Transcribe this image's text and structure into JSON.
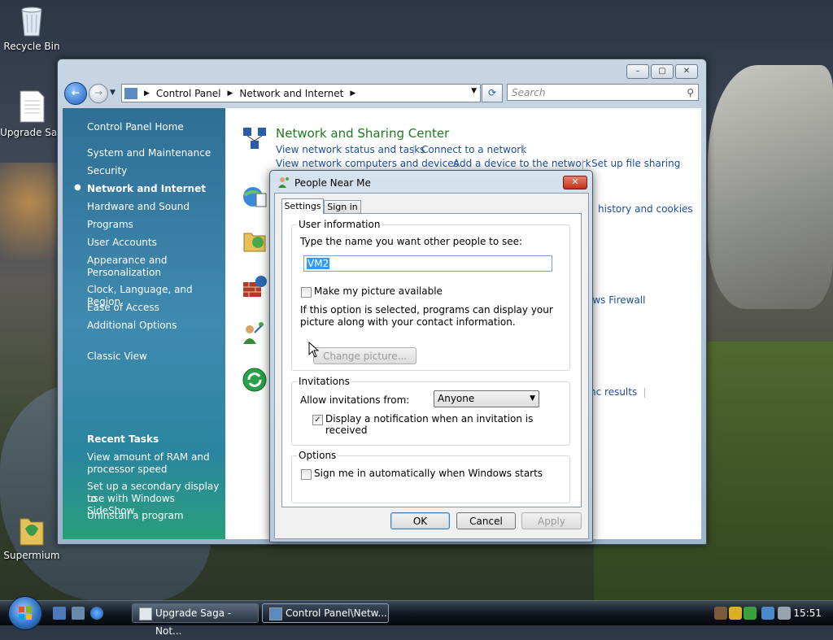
{
  "desktop": {
    "icons": [
      {
        "label": "Recycle Bin",
        "icon": "recycle-bin-icon"
      },
      {
        "label": "Upgrade Sag",
        "icon": "text-document-icon"
      },
      {
        "label": "Supermium",
        "icon": "supermium-browser-icon"
      }
    ]
  },
  "control_panel": {
    "caption_buttons": {
      "minimize": "–",
      "maximize": "▢",
      "close": "✕"
    },
    "address": {
      "seg1": "Control Panel",
      "seg2": "Network and Internet"
    },
    "search_placeholder": "Search",
    "left_nav": {
      "home": "Control Panel Home",
      "items": [
        "System and Maintenance",
        "Security",
        "Network and Internet",
        "Hardware and Sound",
        "Programs",
        "User Accounts",
        "Appearance and",
        "Personalization",
        "Clock, Language, and Region",
        "Ease of Access",
        "Additional Options"
      ],
      "selected_index": 2,
      "classic_view": "Classic View",
      "recent_tasks_title": "Recent Tasks",
      "recent_tasks": [
        "View amount of RAM and",
        "processor speed",
        "Set up a secondary display to",
        "use with Windows SideShow",
        "Uninstall a program"
      ]
    },
    "main": {
      "category_title": "Network and Sharing Center",
      "links": {
        "view_status": "View network status and tasks",
        "connect": "Connect to a network",
        "view_computers": "View network computers and devices",
        "add_device": "Add a device to the network",
        "file_sharing": "Set up file sharing",
        "history": "history and cookies",
        "firewall": "ows Firewall",
        "sync": "nc results"
      }
    }
  },
  "dialog": {
    "title": "People Near Me",
    "close": "✕",
    "tabs": [
      "Settings",
      "Sign in"
    ],
    "active_tab": 0,
    "user_info": {
      "title": "User information",
      "prompt": "Type the name you want other people to see:",
      "name_value": "VM2",
      "picture_checkbox_label": "Make my picture available",
      "picture_checked": false,
      "note_line1": "If this option is selected, programs can display your",
      "note_line2": "picture along with your contact information.",
      "change_picture": "Change picture..."
    },
    "invitations": {
      "title": "Invitations",
      "allow_label": "Allow invitations from:",
      "allow_value": "Anyone",
      "notify_label": "Display a notification when an invitation is received",
      "notify_checked": true
    },
    "options": {
      "title": "Options",
      "auto_signin_label": "Sign me in automatically when Windows starts",
      "auto_signin_checked": false
    },
    "buttons": {
      "ok": "OK",
      "cancel": "Cancel",
      "apply": "Apply"
    }
  },
  "taskbar": {
    "tasks": [
      {
        "label": "Upgrade Saga - Not...",
        "active": false
      },
      {
        "label": "Control Panel\\Netw...",
        "active": true
      }
    ],
    "clock": "15:51"
  }
}
